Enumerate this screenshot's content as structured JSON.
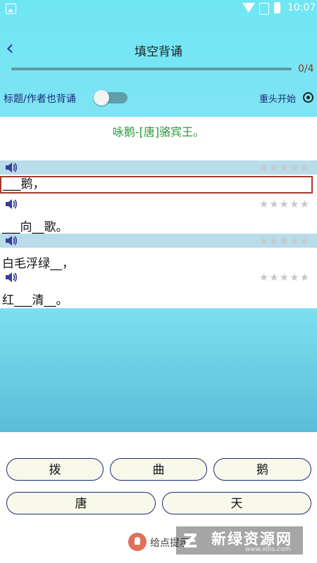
{
  "status_bar": {
    "time": "10:07"
  },
  "header": {
    "title": "填空背诵",
    "progress_text": "0/4",
    "progress_fraction": 0
  },
  "options": {
    "toggle_label": "标题/作者也背诵",
    "toggle_on": false,
    "restart_label": "重头开始"
  },
  "poem": {
    "title_line": "咏鹅-[唐]骆宾王。"
  },
  "lines": [
    {
      "text": "___鹅，",
      "stars": "★★★★★",
      "shaded": true,
      "active": true
    },
    {
      "text": "___向__歌。",
      "stars": "★★★★★",
      "shaded": false,
      "active": false
    },
    {
      "text": "白毛浮绿__，",
      "stars": "★★★★★",
      "shaded": true,
      "active": false
    },
    {
      "text": "红___清__。",
      "stars": "★★★★★",
      "shaded": false,
      "active": false
    }
  ],
  "choices": [
    "拨",
    "曲",
    "鹅",
    "唐",
    "天"
  ],
  "hint_label": "给点提示",
  "watermark": {
    "logo": "Ƶ",
    "name": "新绿资源网",
    "url": "www.xlhs.com"
  },
  "colors": {
    "accent": "#1c2a78",
    "title_green": "#2a9a3a",
    "active_border": "#a33a2a"
  }
}
